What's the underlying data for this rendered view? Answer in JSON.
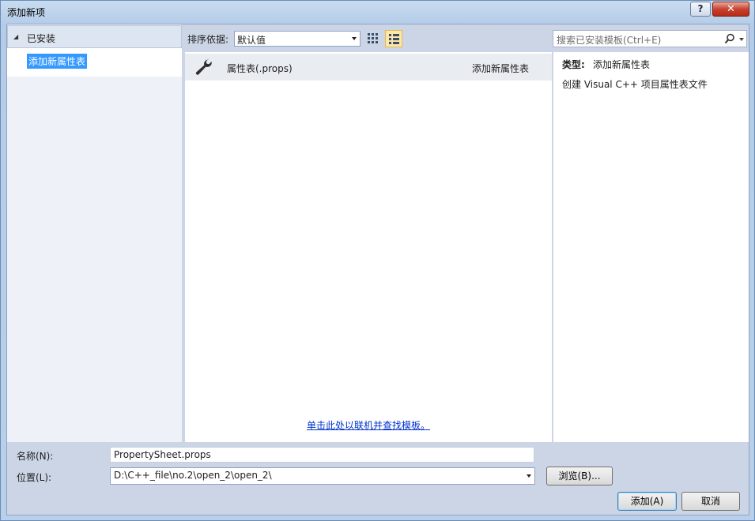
{
  "window": {
    "title": "添加新项",
    "help_label": "?",
    "close_label": "✕"
  },
  "tree": {
    "header": "已安装",
    "selected_item": "添加新属性表"
  },
  "toolbar": {
    "sort_label": "排序依据:",
    "sort_value": "默认值",
    "grid_view_icon": "grid-view-icon",
    "list_view_icon": "list-view-icon"
  },
  "search": {
    "placeholder": "搜索已安装模板(Ctrl+E)",
    "icon": "search-icon"
  },
  "templates": [
    {
      "icon": "wrench-icon",
      "name": "属性表(.props)",
      "category": "添加新属性表"
    }
  ],
  "online_link": "单击此处以联机并查找模板。",
  "details": {
    "type_label": "类型:",
    "type_value": "添加新属性表",
    "description": "创建 Visual C++ 项目属性表文件"
  },
  "form": {
    "name_label": "名称(N):",
    "name_value": "PropertySheet.props",
    "location_label": "位置(L):",
    "location_value": "D:\\C++_file\\no.2\\open_2\\open_2\\",
    "browse_label": "浏览(B)...",
    "add_label": "添加(A)",
    "cancel_label": "取消"
  }
}
